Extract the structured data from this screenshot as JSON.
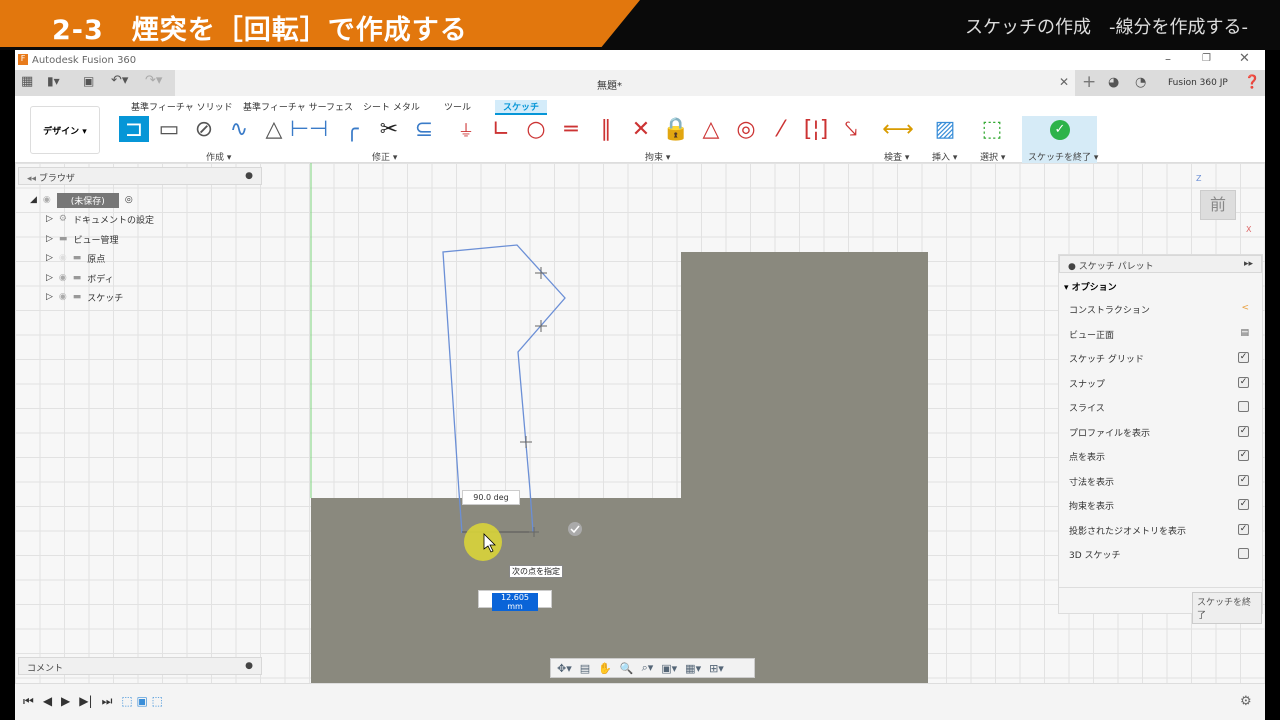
{
  "banner": {
    "title": "2-3　煙突を［回転］で作成する",
    "subtitle": "スケッチの作成　-線分を作成する-"
  },
  "window": {
    "app_title": "Autodesk Fusion 360",
    "doc_title": "無題*",
    "account": "Fusion 360 JP"
  },
  "toolbar": {
    "workspace": "デザイン ▾",
    "tabs": [
      "基準フィーチャ ソリッド",
      "基準フィーチャ サーフェス",
      "シート メタル",
      "ツール",
      "スケッチ"
    ],
    "active_tab": "スケッチ",
    "groups": {
      "create": "作成 ▾",
      "modify": "修正 ▾",
      "constraints": "拘束 ▾",
      "inspect": "検査 ▾",
      "insert": "挿入 ▾",
      "select": "選択 ▾",
      "finish": "スケッチを終了 ▾"
    }
  },
  "browser": {
    "title": "ブラウザ",
    "root": "(未保存)",
    "items": [
      "ドキュメントの設定",
      "ビュー管理",
      "原点",
      "ボディ",
      "スケッチ"
    ]
  },
  "comments": {
    "title": "コメント"
  },
  "viewcube": {
    "face": "前",
    "axis_z": "Z",
    "axis_x": "X"
  },
  "sketch": {
    "angle": "90.0 deg",
    "tooltip": "次の点を指定",
    "length_input": "12.605 mm"
  },
  "palette": {
    "title": "スケッチ パレット",
    "section": "オプション",
    "options": [
      {
        "label": "コンストラクション",
        "type": "icon"
      },
      {
        "label": "ビュー正面",
        "type": "icon"
      },
      {
        "label": "スケッチ グリッド",
        "checked": true
      },
      {
        "label": "スナップ",
        "checked": true
      },
      {
        "label": "スライス",
        "checked": false
      },
      {
        "label": "プロファイルを表示",
        "checked": true
      },
      {
        "label": "点を表示",
        "checked": true
      },
      {
        "label": "寸法を表示",
        "checked": true
      },
      {
        "label": "拘束を表示",
        "checked": true
      },
      {
        "label": "投影されたジオメトリを表示",
        "checked": true
      },
      {
        "label": "3D スケッチ",
        "checked": false
      }
    ],
    "finish": "スケッチを終了"
  },
  "colors": {
    "accent": "#0696d7",
    "banner": "#e2770d",
    "body": "#8a897e",
    "sketch": "#6b8fd6",
    "finish": "#2db34a"
  }
}
